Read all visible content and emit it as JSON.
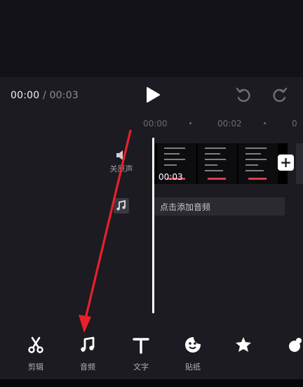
{
  "player": {
    "current_time": "00:00",
    "separator": " / ",
    "total_time": "00:03"
  },
  "ruler": {
    "ticks": [
      "00:00",
      "00:02"
    ]
  },
  "track": {
    "mute_label": "关原声",
    "clip_duration": "00:03",
    "add_clip": "+",
    "add_audio_label": "点击添加音频"
  },
  "toolbar": {
    "items": [
      {
        "label": "剪辑",
        "icon": "scissors-icon"
      },
      {
        "label": "音频",
        "icon": "music-note-icon"
      },
      {
        "label": "文字",
        "icon": "text-t-icon"
      },
      {
        "label": "贴纸",
        "icon": "sticker-icon"
      },
      {
        "label": "",
        "icon": "star-effect-icon"
      },
      {
        "label": "",
        "icon": "filter-icon"
      }
    ]
  },
  "colors": {
    "background": "#1b1b21",
    "preview": "#121218",
    "annotation_arrow": "#e8202a",
    "clip_highlight": "#d24050"
  }
}
